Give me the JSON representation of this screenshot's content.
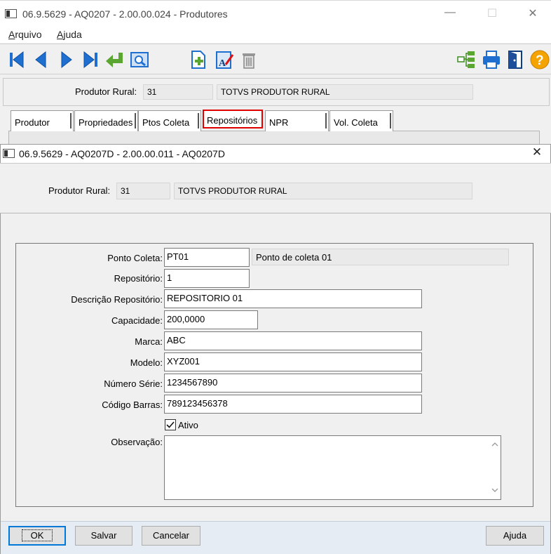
{
  "parent_window": {
    "title": "06.9.5629 - AQ0207 - 2.00.00.024 - Produtores",
    "controls": {
      "minimize": "—",
      "maximize": "☐",
      "close": "✕"
    },
    "menu": [
      {
        "label": "Arquivo"
      },
      {
        "label": "Ajuda"
      }
    ],
    "toolbar": {
      "left": [
        "first-record-icon",
        "previous-record-icon",
        "next-record-icon",
        "last-record-icon",
        "return-icon",
        "search-icon"
      ],
      "middle": [
        "new-document-icon",
        "edit-document-icon",
        "delete-trash-icon"
      ],
      "right": [
        "hierarchy-icon",
        "print-icon",
        "exit-door-icon",
        "help-question-icon"
      ]
    },
    "produtor": {
      "label": "Produtor Rural:",
      "code": "31",
      "name": "TOTVS PRODUTOR RURAL"
    },
    "tabs": [
      "Produtor",
      "Propriedades",
      "Ptos Coleta",
      "Repositórios",
      "NPR",
      "Vol. Coleta"
    ],
    "active_tab": "Repositórios"
  },
  "dialog": {
    "title": "06.9.5629 - AQ0207D - 2.00.00.011 - AQ0207D",
    "close": "✕",
    "produtor": {
      "label": "Produtor Rural:",
      "code": "31",
      "name": "TOTVS PRODUTOR RURAL"
    },
    "form": {
      "ponto_coleta": {
        "label": "Ponto Coleta:",
        "value": "PT01",
        "description": "Ponto de coleta 01"
      },
      "repositorio": {
        "label": "Repositório:",
        "value": "1"
      },
      "descricao": {
        "label": "Descrição Repositório:",
        "value": "REPOSITORIO 01"
      },
      "capacidade": {
        "label": "Capacidade:",
        "value": "200,0000"
      },
      "marca": {
        "label": "Marca:",
        "value": "ABC"
      },
      "modelo": {
        "label": "Modelo:",
        "value": "XYZ001"
      },
      "numero_serie": {
        "label": "Número Série:",
        "value": "1234567890"
      },
      "codigo_barras": {
        "label": "Código Barras:",
        "value": "789123456378"
      },
      "ativo": {
        "label": "Ativo",
        "checked": true
      },
      "observacao": {
        "label": "Observação:",
        "value": ""
      }
    },
    "buttons": {
      "ok": "OK",
      "salvar": "Salvar",
      "cancelar": "Cancelar",
      "ajuda": "Ajuda"
    }
  },
  "colors": {
    "highlight_border": "#e00000",
    "toolbar_blue": "#1f6fd1",
    "toolbar_green": "#5aa631",
    "help_orange": "#f5a300"
  }
}
